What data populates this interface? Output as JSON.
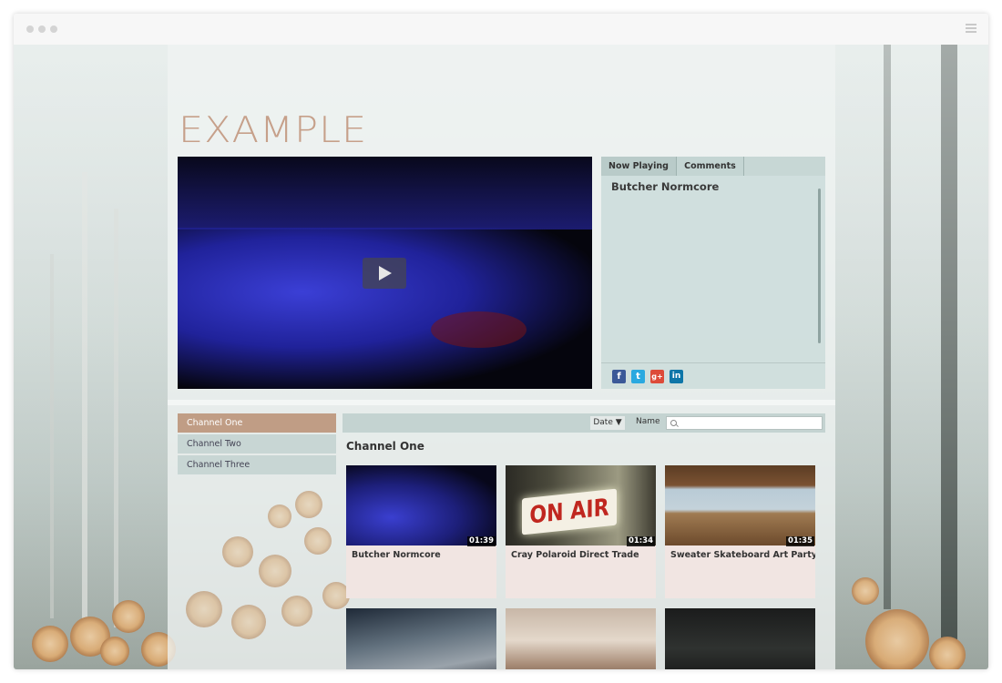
{
  "brand": {
    "logo_text": "EXAMPLE"
  },
  "player": {
    "play_label": "Play",
    "tabs": [
      {
        "label": "Now Playing"
      },
      {
        "label": "Comments"
      }
    ],
    "now_playing_title": "Butcher Normcore",
    "share": [
      {
        "name": "facebook",
        "glyph": "f",
        "color": "#3b5998"
      },
      {
        "name": "twitter",
        "glyph": "t",
        "color": "#2aa9e0"
      },
      {
        "name": "google-plus",
        "glyph": "g+",
        "color": "#dd4b39"
      },
      {
        "name": "linkedin",
        "glyph": "in",
        "color": "#0e76a8"
      }
    ]
  },
  "channels": [
    {
      "label": "Channel One",
      "active": true
    },
    {
      "label": "Channel Two",
      "active": false
    },
    {
      "label": "Channel Three",
      "active": false
    }
  ],
  "filter": {
    "sort_label": "Date ▼",
    "name_label": "Name",
    "search_placeholder": ""
  },
  "section": {
    "title": "Channel One"
  },
  "videos": [
    {
      "title": "Butcher Normcore",
      "duration": "01:39"
    },
    {
      "title": "Cray Polaroid Direct Trade",
      "duration": "01:34",
      "sign_text": "ON AIR"
    },
    {
      "title": "Sweater Skateboard Art Party",
      "duration": "01:35"
    },
    {
      "title": "",
      "duration": ""
    },
    {
      "title": "",
      "duration": ""
    },
    {
      "title": "",
      "duration": ""
    }
  ]
}
